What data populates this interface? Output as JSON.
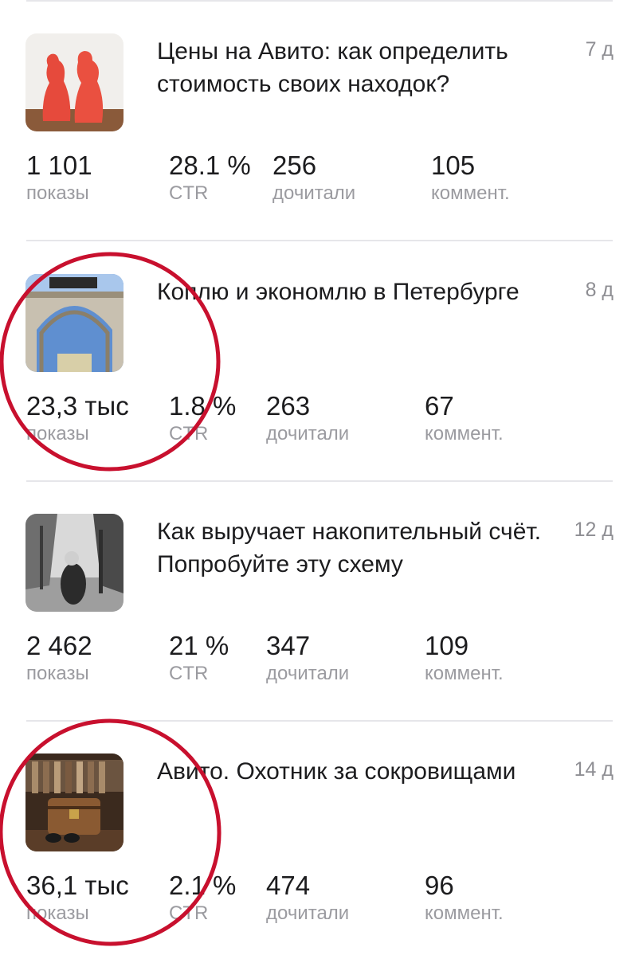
{
  "articles": [
    {
      "title": "Цены на Авито: как определить стоимость своих находок?",
      "age": "7 д",
      "thumbnail_icon": "red-figurines-photo",
      "stats": [
        {
          "value": "1 101",
          "label": "показы"
        },
        {
          "value": "28.1 %",
          "label": "CTR"
        },
        {
          "value": "256",
          "label": "дочитали"
        },
        {
          "value": "105",
          "label": "коммент."
        }
      ]
    },
    {
      "title": "Коплю и экономлю в Петербурге",
      "age": "8 д",
      "thumbnail_icon": "arch-photo",
      "stats": [
        {
          "value": "23,3 тыс",
          "label": "показы"
        },
        {
          "value": "1.8 %",
          "label": "CTR"
        },
        {
          "value": "263",
          "label": "дочитали"
        },
        {
          "value": "67",
          "label": "коммент."
        }
      ]
    },
    {
      "title": "Как выручает накопительный счёт. Попробуйте эту схему",
      "age": "12 д",
      "thumbnail_icon": "autumn-alley-photo",
      "stats": [
        {
          "value": "2 462",
          "label": "показы"
        },
        {
          "value": "21 %",
          "label": "CTR"
        },
        {
          "value": "347",
          "label": "дочитали"
        },
        {
          "value": "109",
          "label": "коммент."
        }
      ]
    },
    {
      "title": "Авито. Охотник за сокровищами",
      "age": "14 д",
      "thumbnail_icon": "treasure-chest-photo",
      "stats": [
        {
          "value": "36,1 тыс",
          "label": "показы"
        },
        {
          "value": "2.1 %",
          "label": "CTR"
        },
        {
          "value": "474",
          "label": "дочитали"
        },
        {
          "value": "96",
          "label": "коммент."
        }
      ]
    }
  ],
  "colors": {
    "text": "#1c1c1e",
    "muted": "#8e8e93",
    "divider": "#e6e6ea",
    "annotation_circle": "#c8102e"
  }
}
